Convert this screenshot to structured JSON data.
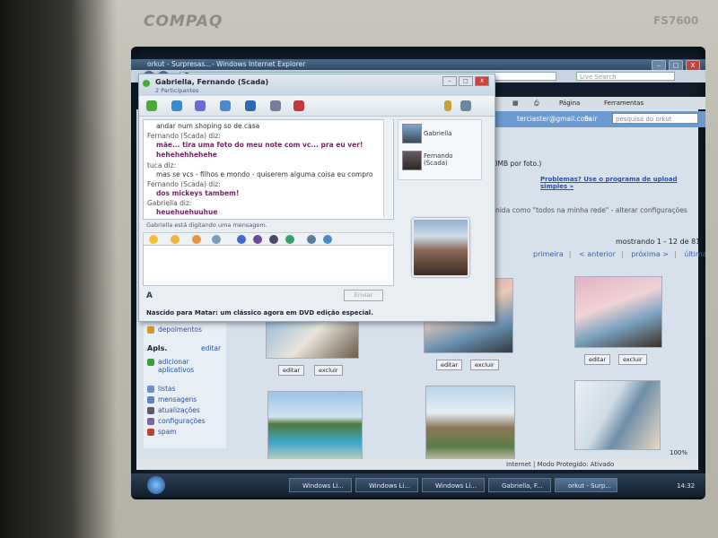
{
  "monitor": {
    "brand": "COMPAQ",
    "model": "FS7600"
  },
  "ie": {
    "title_prefix": "orkut - Surpresas...",
    "title": "- Windows Internet Explorer",
    "url": "http://www.orkut.com/Album.aspx?uid=4043996787020473868&aid=1211277978",
    "live_search_placeholder": "Live Search",
    "toolbar": {
      "page": "Página",
      "tools": "Ferramentas"
    },
    "win_buttons": {
      "minimize": "–",
      "maximize": "□",
      "close": "X"
    },
    "status": "Internet | Modo Protegido: Ativado",
    "zoom": "100%"
  },
  "orkut": {
    "email": "terciaster@gmail.com",
    "logout": "Sair",
    "search_placeholder": "pesquisa do orkut",
    "upload_note": "e 10MB por foto.)",
    "problem_link": "Problemas? Use o programa de upload simples »",
    "privacy_note": "definida como \"todos na minha rede\" - alterar configurações",
    "showing": "mostrando 1 - 12 de 81",
    "pager": {
      "first": "primeira",
      "prev": "< anterior",
      "next": "próxima >",
      "last": "última"
    },
    "photo_edit": "editar",
    "photo_delete": "excluir",
    "sidebar": {
      "depoimentos": "depoimentos",
      "apls_title": "Apls.",
      "apls_edit": "editar",
      "add_apps": "adicionar aplicativos",
      "items": [
        "listas",
        "mensagens",
        "atualizações",
        "configurações",
        "spam"
      ]
    }
  },
  "chat": {
    "title": "Gabriella, Fernando (Scada)",
    "subtitle": "2 Participantes",
    "win_buttons": {
      "minimize": "–",
      "maximize": "□",
      "close": "X"
    },
    "messages": [
      {
        "kind": "body",
        "text": "andar num shoping so de casa"
      },
      {
        "kind": "sender",
        "text": "Fernando (Scada) diz:"
      },
      {
        "kind": "bold",
        "text": "mãe... tira uma foto do meu note com vc... pra eu ver!"
      },
      {
        "kind": "bold",
        "text": "hehehehhehehe"
      },
      {
        "kind": "sender",
        "text": "tuca diz:"
      },
      {
        "kind": "body",
        "text": "mas se vcs - filhos e mondo - quiserem alguma coisa eu compro"
      },
      {
        "kind": "sender",
        "text": "Fernando (Scada) diz:"
      },
      {
        "kind": "bold",
        "text": "dos mickeys tambem!"
      },
      {
        "kind": "sender",
        "text": "Gabriella diz:"
      },
      {
        "kind": "bold",
        "text": "heuehuehuuhue"
      }
    ],
    "typing": "Gabriella está digitando uma mensagem.",
    "send": "Enviar",
    "font_button": "A",
    "ad": "Nascido para Matar: um clássico agora em DVD edição especial.",
    "participants": [
      {
        "name": "Gabriella"
      },
      {
        "name": "Fernando (Scada)"
      }
    ]
  },
  "taskbar": {
    "tasks": [
      "Windows Li...",
      "Windows Li...",
      "Windows Li...",
      "Gabriella, F...",
      "orkut - Surp..."
    ],
    "active_index": 4,
    "clock": "14:32"
  }
}
